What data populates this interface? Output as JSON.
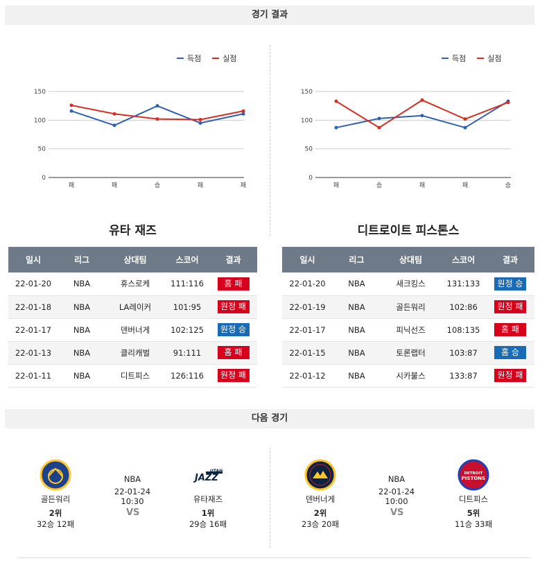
{
  "results_header": "경기 결과",
  "next_header": "다음 경기",
  "legend": {
    "score": "득점",
    "allowed": "실점"
  },
  "colors": {
    "score": "#2f5fb3",
    "allowed": "#d62d20",
    "loss": "#d6001c",
    "win": "#1a6bb5",
    "header": "#6e7a87"
  },
  "chart_data": [
    {
      "type": "line",
      "categories": [
        "패",
        "패",
        "승",
        "패",
        "패"
      ],
      "yticks": [
        0,
        50,
        100,
        150
      ],
      "ylim": [
        0,
        150
      ],
      "series": [
        {
          "name": "득점",
          "values": [
            116,
            91,
            125,
            95,
            111
          ]
        },
        {
          "name": "실점",
          "values": [
            126,
            111,
            102,
            101,
            116
          ]
        }
      ],
      "legend": "top-right",
      "grid": true
    },
    {
      "type": "line",
      "categories": [
        "패",
        "승",
        "패",
        "패",
        "승"
      ],
      "yticks": [
        0,
        50,
        100,
        150
      ],
      "ylim": [
        0,
        150
      ],
      "series": [
        {
          "name": "득점",
          "values": [
            87,
            103,
            108,
            87,
            133
          ]
        },
        {
          "name": "실점",
          "values": [
            133,
            87,
            135,
            102,
            131
          ]
        }
      ],
      "legend": "top-right",
      "grid": true
    }
  ],
  "teams": [
    {
      "name": "유타 재즈",
      "columns": [
        "일시",
        "리그",
        "상대팀",
        "스코어",
        "결과"
      ],
      "rows": [
        {
          "date": "22-01-20",
          "league": "NBA",
          "opponent": "휴스로케",
          "score": "111:116",
          "result": "홈 패",
          "win": false
        },
        {
          "date": "22-01-18",
          "league": "NBA",
          "opponent": "LA레이커",
          "score": "101:95",
          "result": "원정 패",
          "win": false
        },
        {
          "date": "22-01-17",
          "league": "NBA",
          "opponent": "덴버너게",
          "score": "102:125",
          "result": "원정 승",
          "win": true
        },
        {
          "date": "22-01-13",
          "league": "NBA",
          "opponent": "클리캐벌",
          "score": "91:111",
          "result": "홈 패",
          "win": false
        },
        {
          "date": "22-01-11",
          "league": "NBA",
          "opponent": "디트피스",
          "score": "126:116",
          "result": "원정 패",
          "win": false
        }
      ]
    },
    {
      "name": "디트로이트 피스톤스",
      "columns": [
        "일시",
        "리그",
        "상대팀",
        "스코어",
        "결과"
      ],
      "rows": [
        {
          "date": "22-01-20",
          "league": "NBA",
          "opponent": "새크킹스",
          "score": "131:133",
          "result": "원정 승",
          "win": true
        },
        {
          "date": "22-01-19",
          "league": "NBA",
          "opponent": "골든워리",
          "score": "102:86",
          "result": "원정 패",
          "win": false
        },
        {
          "date": "22-01-17",
          "league": "NBA",
          "opponent": "피닉선즈",
          "score": "108:135",
          "result": "홈 패",
          "win": false
        },
        {
          "date": "22-01-15",
          "league": "NBA",
          "opponent": "토론랩터",
          "score": "103:87",
          "result": "홈 승",
          "win": true
        },
        {
          "date": "22-01-12",
          "league": "NBA",
          "opponent": "시카불스",
          "score": "133:87",
          "result": "원정 패",
          "win": false
        }
      ]
    }
  ],
  "next_games": [
    {
      "league": "NBA",
      "datetime": "22-01-24 10:30",
      "vs": "VS",
      "home": {
        "name": "골든워리",
        "rank": "2위",
        "record": "32승 12패",
        "logo": "warriors-logo"
      },
      "away": {
        "name": "유타재즈",
        "rank": "1위",
        "record": "29승 16패",
        "logo": "jazz-logo"
      }
    },
    {
      "league": "NBA",
      "datetime": "22-01-24 10:00",
      "vs": "VS",
      "home": {
        "name": "덴버너게",
        "rank": "2위",
        "record": "23승 20패",
        "logo": "nuggets-logo"
      },
      "away": {
        "name": "디트피스",
        "rank": "5위",
        "record": "11승 33패",
        "logo": "pistons-logo"
      }
    }
  ],
  "logo_text": {
    "jazz": "JAZZ",
    "jazz_utah": "UTAH",
    "pistons_a": "DETROIT",
    "pistons_b": "PISTONS"
  }
}
